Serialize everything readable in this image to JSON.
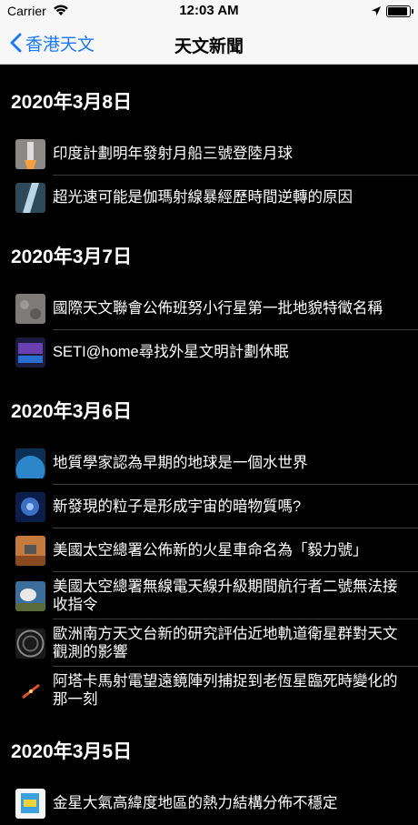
{
  "status": {
    "carrier": "Carrier",
    "time": "12:03 AM"
  },
  "nav": {
    "back_label": "香港天文",
    "title": "天文新聞"
  },
  "sections": [
    {
      "date": "2020年3月8日",
      "items": [
        {
          "title": "印度計劃明年發射月船三號登陸月球",
          "icon": "rocket-launch-thumbnail"
        },
        {
          "title": "超光速可能是伽瑪射線暴經歷時間逆轉的原因",
          "icon": "gamma-ray-burst-thumbnail"
        }
      ]
    },
    {
      "date": "2020年3月7日",
      "items": [
        {
          "title": "國際天文聯會公佈班努小行星第一批地貌特徵名稱",
          "icon": "asteroid-surface-thumbnail"
        },
        {
          "title": "SETI@home尋找外星文明計劃休眠",
          "icon": "seti-screen-thumbnail"
        }
      ]
    },
    {
      "date": "2020年3月6日",
      "items": [
        {
          "title": "地質學家認為早期的地球是一個水世界",
          "icon": "ocean-world-thumbnail"
        },
        {
          "title": "新發現的粒子是形成宇宙的暗物質嗎?",
          "icon": "dark-matter-thumbnail"
        },
        {
          "title": "美國太空總署公佈新的火星車命名為「毅力號」",
          "icon": "mars-rover-thumbnail"
        },
        {
          "title": "美國太空總署無線電天線升級期間航行者二號無法接收指令",
          "icon": "radio-antenna-thumbnail"
        },
        {
          "title": "歐洲南方天文台新的研究評估近地軌道衛星群對天文觀測的影響",
          "icon": "satellite-trails-thumbnail"
        },
        {
          "title": "阿塔卡馬射電望遠鏡陣列捕捉到老恆星臨死時變化的那一刻",
          "icon": "dying-star-thumbnail"
        }
      ]
    },
    {
      "date": "2020年3月5日",
      "items": [
        {
          "title": "金星大氣高緯度地區的熱力結構分佈不穩定",
          "icon": "venus-thermal-map-thumbnail"
        }
      ]
    }
  ]
}
